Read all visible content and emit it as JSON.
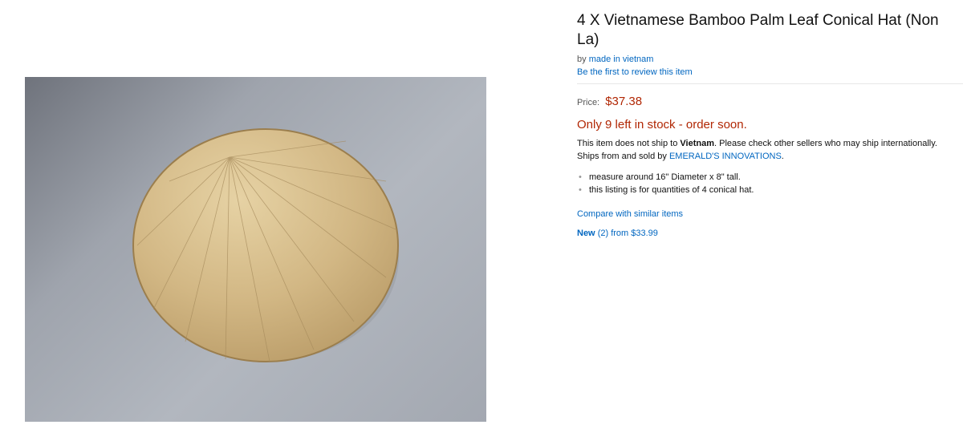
{
  "product": {
    "title": "4 X Vietnamese Bamboo Palm Leaf Conical Hat (Non La)",
    "by_prefix": "by",
    "brand": "made in vietnam",
    "review_link": "Be the first to review this item",
    "price_label": "Price:",
    "price": "$37.38",
    "stock": "Only 9 left in stock - order soon.",
    "ship_text_1": "This item does not ship to",
    "ship_country": "Vietnam",
    "ship_text_2": ". Please check other sellers who may ship internationally.",
    "ships_from_prefix": "Ships from and sold by",
    "seller": "EMERALD'S INNOVATIONS",
    "ships_from_suffix": ".",
    "bullets": [
      "measure around 16\" Diameter x 8\" tall.",
      "this listing is for quantities of 4 conical hat."
    ],
    "compare_link": "Compare with similar items",
    "new_label": "New",
    "new_count": "(2)",
    "new_from": "from",
    "new_price": "$33.99"
  },
  "colors": {
    "link": "#0066c0",
    "price": "#b12704"
  }
}
